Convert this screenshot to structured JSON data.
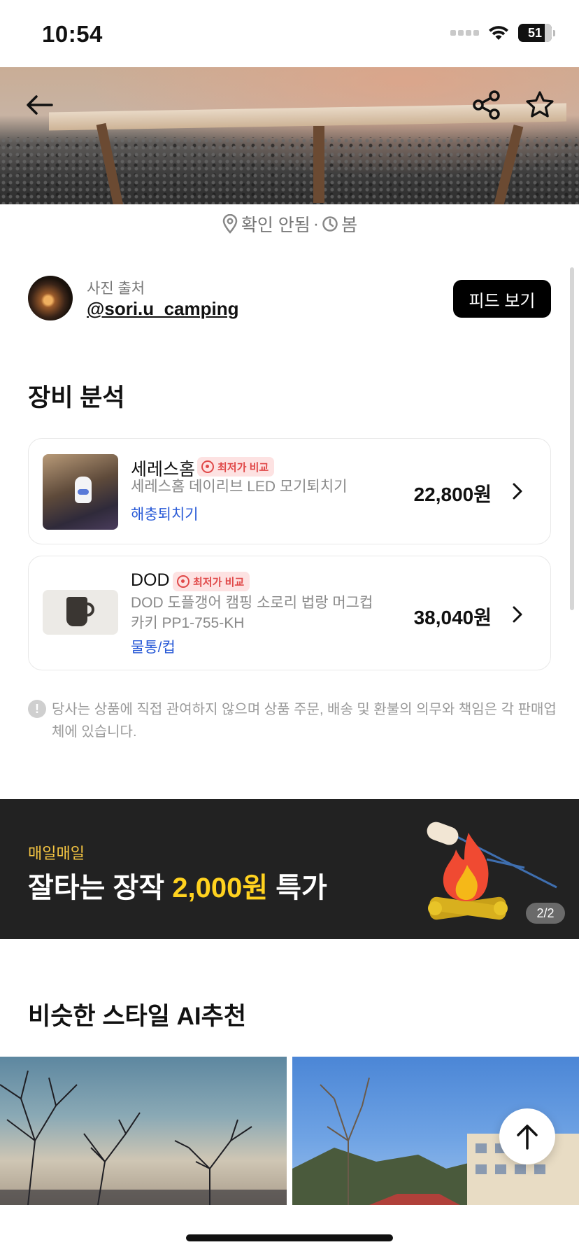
{
  "status_bar": {
    "time": "10:54",
    "battery": "51"
  },
  "location": {
    "place": "확인 안됨",
    "separator": "·",
    "season": "봄"
  },
  "source": {
    "caption": "사진 출처",
    "handle": "@sori.u_camping",
    "feed_button": "피드 보기"
  },
  "gear_analysis": {
    "title": "장비 분석",
    "products": [
      {
        "brand": "세레스홈",
        "badge": "최저가 비교",
        "name": "세레스홈 데이리브 LED 모기퇴치기",
        "category": "해충퇴치기",
        "price": "22,800원"
      },
      {
        "brand": "DOD",
        "badge": "최저가 비교",
        "name": "DOD 도플갱어 캠핑 소로리 법랑 머그컵 카키 PP1-755-KH",
        "category": "물통/컵",
        "price": "38,040원"
      }
    ],
    "disclaimer": "당사는 상품에 직접 관여하지 않으며 상품 주문, 배송 및 환불의 의무와 책임은 각 판매업체에 있습니다."
  },
  "banner": {
    "label": "매일매일",
    "title_pre": "잘타는 장작 ",
    "title_highlight": "2,000원",
    "title_post": " 특가",
    "page": "2/2"
  },
  "similar": {
    "title": "비슷한 스타일 AI추천"
  },
  "icons": [
    "back-arrow-icon",
    "share-icon",
    "star-icon",
    "location-pin-icon",
    "clock-icon",
    "chevron-right-icon",
    "info-icon",
    "arrow-up-icon",
    "wifi-icon",
    "battery-icon"
  ],
  "colors": {
    "accent_link": "#2a5bd7",
    "badge_bg": "#fde2e2",
    "badge_text": "#e04848",
    "banner_bg": "#222222",
    "banner_highlight": "#ffd21f"
  }
}
